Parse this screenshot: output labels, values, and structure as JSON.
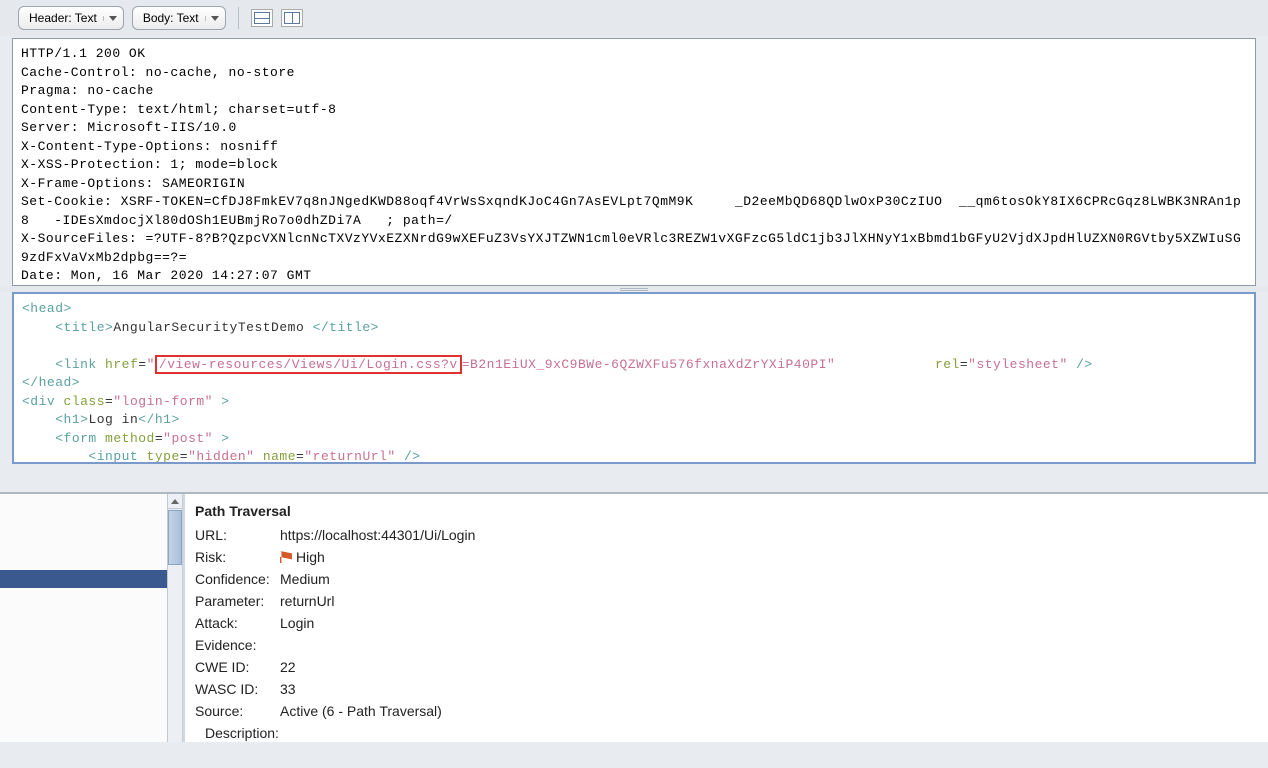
{
  "toolbar": {
    "header_select": "Header: Text",
    "body_select": "Body: Text"
  },
  "headers_text": "HTTP/1.1 200 OK\nCache-Control: no-cache, no-store\nPragma: no-cache\nContent-Type: text/html; charset=utf-8\nServer: Microsoft-IIS/10.0\nX-Content-Type-Options: nosniff\nX-XSS-Protection: 1; mode=block\nX-Frame-Options: SAMEORIGIN\nSet-Cookie: XSRF-TOKEN=CfDJ8FmkEV7q8nJNgedKWD88oqf4VrWsSxqndKJoC4Gn7AsEVLpt7QmM9K     _D2eeMbQD68QDlwOxP30CzIUO  __qm6tosOkY8IX6CPRcGqz8LWBK3NRAn1p8   -IDEsXmdocjXl80dOSh1EUBmjRo7o0dhZDi7A   ; path=/\nX-SourceFiles: =?UTF-8?B?QzpcVXNlcnNcTXVzYVxEZXNrdG9wXEFuZ3VsYXJTZWN1cml0eVRlc3REZW1vXGFzcG5ldC1jb3JlXHNyY1xBbmd1bGFyU2VjdXJpdHlUZXN0RGVtby5XZWIuSG9zdFxVaVxMb2dpbg==?=\nDate: Mon, 16 Mar 2020 14:27:07 GMT",
  "body_html": {
    "title_text": "AngularSecurityTestDemo",
    "link_highlight": "/view-resources/Views/Ui/Login.css?v",
    "link_rest": "=B2n1EiUX_9xC9BWe-6QZWXFu576fxnaXdZrYXiP40PI\"",
    "rel_val": "\"stylesheet\"",
    "class_val": "\"login-form\"",
    "h1_text": "Log in",
    "method_val": "\"post\"",
    "type_val": "\"hidden\"",
    "name_val": "\"returnUrl\""
  },
  "alert": {
    "title": "Path Traversal",
    "url_label": "URL:",
    "url_value": "https://localhost:44301/Ui/Login",
    "risk_label": "Risk:",
    "risk_value": "High",
    "confidence_label": "Confidence:",
    "confidence_value": "Medium",
    "parameter_label": "Parameter:",
    "parameter_value": "returnUrl",
    "attack_label": "Attack:",
    "attack_value": "Login",
    "evidence_label": "Evidence:",
    "evidence_value": "",
    "cwe_label": "CWE ID:",
    "cwe_value": "22",
    "wasc_label": "WASC ID:",
    "wasc_value": "33",
    "source_label": "Source:",
    "source_value": "Active (6 - Path Traversal)",
    "desc_label": "Description:"
  }
}
